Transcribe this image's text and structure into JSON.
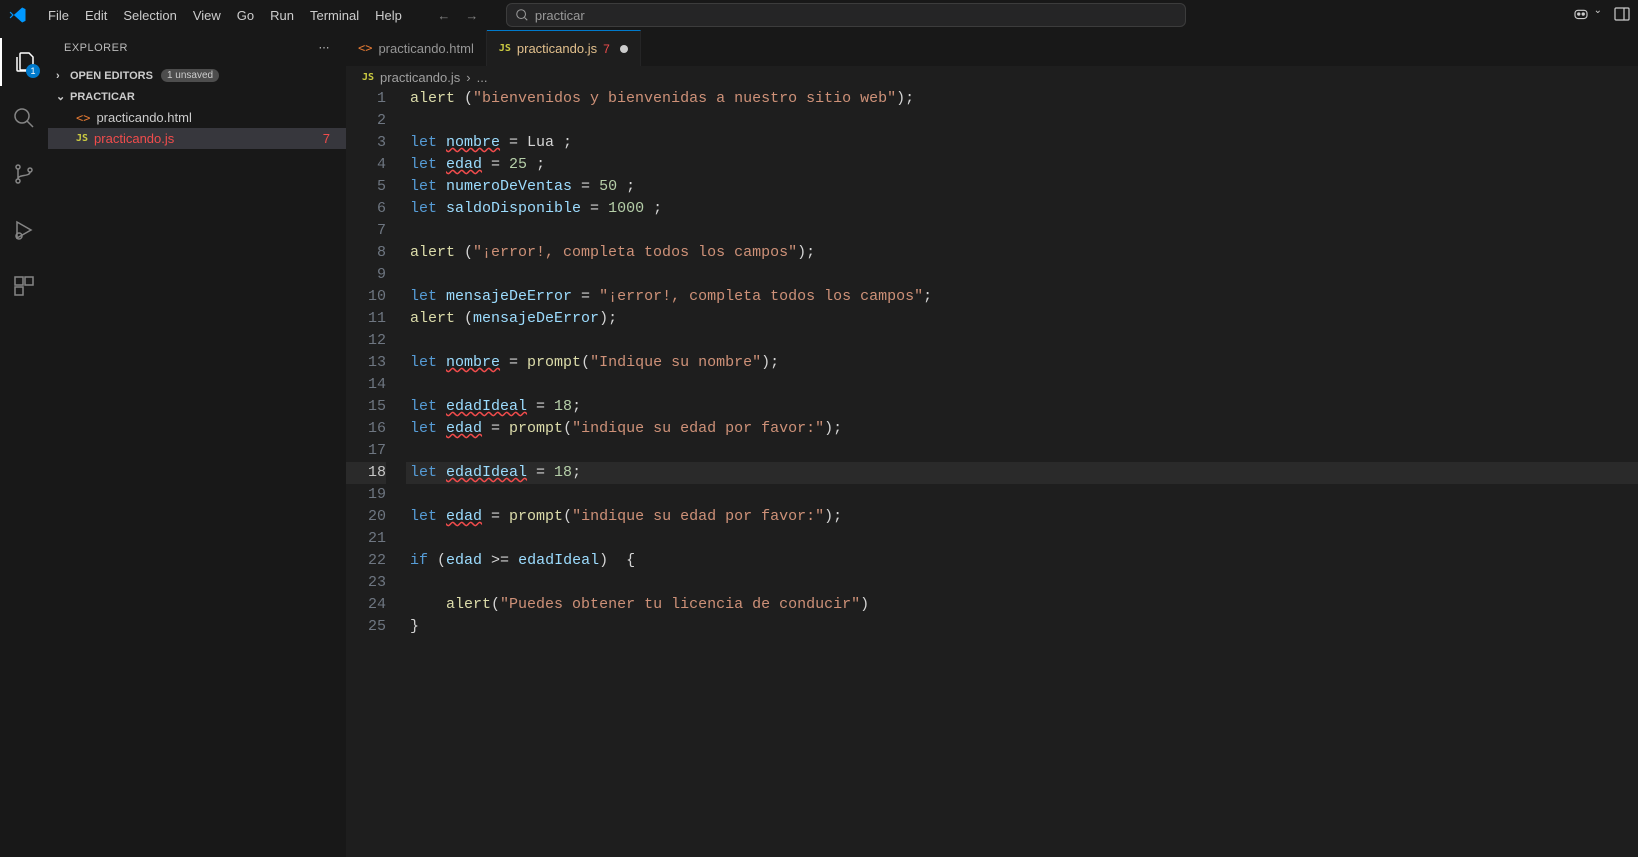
{
  "menu": {
    "items": [
      "File",
      "Edit",
      "Selection",
      "View",
      "Go",
      "Run",
      "Terminal",
      "Help"
    ]
  },
  "search": {
    "label": "practicar"
  },
  "activity": {
    "badge": "1"
  },
  "explorer": {
    "title": "EXPLORER",
    "open_editors": "OPEN EDITORS",
    "unsaved_badge": "1 unsaved",
    "folder": "PRACTICAR",
    "files": [
      {
        "name": "practicando.html",
        "icon": "<>",
        "error": false,
        "problems": ""
      },
      {
        "name": "practicando.js",
        "icon": "JS",
        "error": true,
        "problems": "7"
      }
    ]
  },
  "tabs": [
    {
      "name": "practicando.html",
      "icon": "<>",
      "active": false,
      "badge": "",
      "modified": false
    },
    {
      "name": "practicando.js",
      "icon": "JS",
      "active": true,
      "badge": "7",
      "modified": true
    }
  ],
  "breadcrumb": {
    "icon": "JS",
    "file": "practicando.js",
    "suffix": "..."
  },
  "code": {
    "lines": [
      {
        "n": 1,
        "tokens": [
          [
            "fn",
            "alert"
          ],
          [
            "pun",
            " ("
          ],
          [
            "str",
            "\"bienvenidos y bienvenidas a nuestro sitio web\""
          ],
          [
            "pun",
            ");"
          ]
        ]
      },
      {
        "n": 2,
        "tokens": []
      },
      {
        "n": 3,
        "tokens": [
          [
            "kw",
            "let "
          ],
          [
            "var",
            "nombre",
            true
          ],
          [
            "pun",
            " = Lua ;"
          ]
        ]
      },
      {
        "n": 4,
        "tokens": [
          [
            "kw",
            "let "
          ],
          [
            "var",
            "edad",
            true
          ],
          [
            "pun",
            " = "
          ],
          [
            "num",
            "25"
          ],
          [
            "pun",
            " ;"
          ]
        ]
      },
      {
        "n": 5,
        "tokens": [
          [
            "kw",
            "let "
          ],
          [
            "var",
            "numeroDeVentas"
          ],
          [
            "pun",
            " = "
          ],
          [
            "num",
            "50"
          ],
          [
            "pun",
            " ;"
          ]
        ]
      },
      {
        "n": 6,
        "tokens": [
          [
            "kw",
            "let "
          ],
          [
            "var",
            "saldoDisponible"
          ],
          [
            "pun",
            " = "
          ],
          [
            "num",
            "1000"
          ],
          [
            "pun",
            " ;"
          ]
        ]
      },
      {
        "n": 7,
        "tokens": []
      },
      {
        "n": 8,
        "tokens": [
          [
            "fn",
            "alert"
          ],
          [
            "pun",
            " ("
          ],
          [
            "str",
            "\"¡error!, completa todos los campos\""
          ],
          [
            "pun",
            ");"
          ]
        ]
      },
      {
        "n": 9,
        "tokens": []
      },
      {
        "n": 10,
        "tokens": [
          [
            "kw",
            "let "
          ],
          [
            "var",
            "mensajeDeError"
          ],
          [
            "pun",
            " = "
          ],
          [
            "str",
            "\"¡error!, completa todos los campos\""
          ],
          [
            "pun",
            ";"
          ]
        ]
      },
      {
        "n": 11,
        "tokens": [
          [
            "fn",
            "alert"
          ],
          [
            "pun",
            " ("
          ],
          [
            "var",
            "mensajeDeError"
          ],
          [
            "pun",
            ");"
          ]
        ]
      },
      {
        "n": 12,
        "tokens": []
      },
      {
        "n": 13,
        "tokens": [
          [
            "kw",
            "let "
          ],
          [
            "var",
            "nombre",
            true
          ],
          [
            "pun",
            " = "
          ],
          [
            "fn",
            "prompt"
          ],
          [
            "pun",
            "("
          ],
          [
            "str",
            "\"Indique su nombre\""
          ],
          [
            "pun",
            ");"
          ]
        ]
      },
      {
        "n": 14,
        "tokens": []
      },
      {
        "n": 15,
        "tokens": [
          [
            "kw",
            "let "
          ],
          [
            "var",
            "edadIdeal",
            true
          ],
          [
            "pun",
            " = "
          ],
          [
            "num",
            "18"
          ],
          [
            "pun",
            ";"
          ]
        ]
      },
      {
        "n": 16,
        "tokens": [
          [
            "kw",
            "let "
          ],
          [
            "var",
            "edad",
            true
          ],
          [
            "pun",
            " = "
          ],
          [
            "fn",
            "prompt"
          ],
          [
            "pun",
            "("
          ],
          [
            "str",
            "\"indique su edad por favor:\""
          ],
          [
            "pun",
            ");"
          ]
        ]
      },
      {
        "n": 17,
        "tokens": []
      },
      {
        "n": 18,
        "current": true,
        "tokens": [
          [
            "kw",
            "let "
          ],
          [
            "var",
            "edadIdeal",
            true
          ],
          [
            "pun",
            " = "
          ],
          [
            "num",
            "18"
          ],
          [
            "pun",
            ";"
          ]
        ]
      },
      {
        "n": 19,
        "tokens": []
      },
      {
        "n": 20,
        "tokens": [
          [
            "kw",
            "let "
          ],
          [
            "var",
            "edad",
            true
          ],
          [
            "pun",
            " = "
          ],
          [
            "fn",
            "prompt"
          ],
          [
            "pun",
            "("
          ],
          [
            "str",
            "\"indique su edad por favor:\""
          ],
          [
            "pun",
            ");"
          ]
        ]
      },
      {
        "n": 21,
        "tokens": []
      },
      {
        "n": 22,
        "tokens": [
          [
            "kw",
            "if"
          ],
          [
            "pun",
            " ("
          ],
          [
            "var",
            "edad"
          ],
          [
            "pun",
            " >= "
          ],
          [
            "var",
            "edadIdeal"
          ],
          [
            "pun",
            ")  {"
          ]
        ]
      },
      {
        "n": 23,
        "tokens": []
      },
      {
        "n": 24,
        "tokens": [
          [
            "pun",
            "    "
          ],
          [
            "fn",
            "alert"
          ],
          [
            "pun",
            "("
          ],
          [
            "str",
            "\"Puedes obtener tu licencia de conducir\""
          ],
          [
            "pun",
            ")"
          ]
        ]
      },
      {
        "n": 25,
        "tokens": [
          [
            "pun",
            "}"
          ]
        ]
      }
    ]
  }
}
